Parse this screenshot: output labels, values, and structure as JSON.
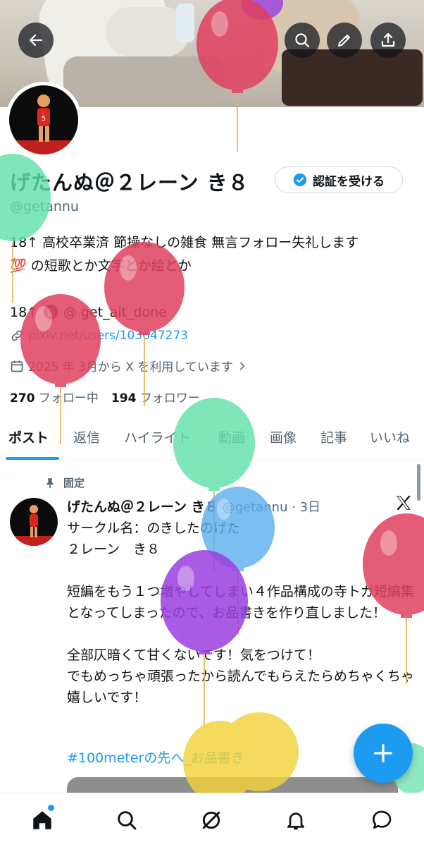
{
  "header": {
    "back_icon": "arrow-left-icon",
    "search_icon": "search-icon",
    "edit_icon": "pencil-icon",
    "share_icon": "share-icon"
  },
  "profile": {
    "display_name": "げたんぬ＠２レーン き８",
    "verify_button": "認証を受ける",
    "handle": "@getannu",
    "bio_line1": "18↑ 高校卒業済 節操なしの雑食 無言フォロー失礼します",
    "bio_line2": "💯 の短歌とか文字とか絵とか",
    "bio_line3": "18↑ 🔞 @ get_ait_done",
    "link": "pixiv.net/users/103647273",
    "joined": "2025 年 3月から X を利用しています",
    "following_count": "270",
    "following_label": "フォロー中",
    "followers_count": "194",
    "followers_label": "フォロワー"
  },
  "tabs": [
    "ポスト",
    "返信",
    "ハイライト",
    "動画",
    "画像",
    "記事",
    "いいね"
  ],
  "pinned_post": {
    "pinned_label": "固定",
    "author": "げたんぬ＠２レーン き８",
    "handle_time": "@getannu · 3日",
    "text": "サークル名：のきしたのげた\n２レーン　き８\n\n短編をもう１つ増やしてしまい４作品構成の寺トガ短編集となってしまったので、お品書きを作り直しました！\n\n全部仄暗くて甘くないです！気をつけて！\nでもめっちゃ頑張ったから読んでもらえたらめちゃくちゃ嬉しいです！",
    "hashtag": "#100meterの先へ_お品書き"
  },
  "bottom_nav": [
    "home-icon",
    "search-icon",
    "grok-icon",
    "notifications-icon",
    "messages-icon"
  ],
  "colors": {
    "accent": "#1d9bf0",
    "text": "#0f1419",
    "secondary_text": "#536471",
    "balloon_red": "#e0405e",
    "balloon_green": "#5fe0a8",
    "balloon_blue": "#5aaef0",
    "balloon_purple": "#9b3fe0",
    "balloon_yellow": "#f2d23a"
  }
}
